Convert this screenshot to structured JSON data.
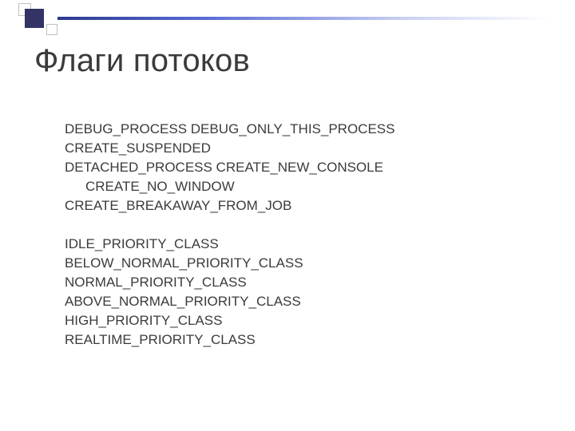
{
  "title": "Флаги потоков",
  "group1": {
    "l1": "DEBUG_PROCESS DEBUG_ONLY_THIS_PROCESS",
    "l2": "CREATE_SUSPENDED",
    "l3": "DETACHED_PROCESS CREATE_NEW_CONSOLE",
    "l3b": "CREATE_NO_WINDOW",
    "l4": "CREATE_BREAKAWAY_FROM_JOB"
  },
  "group2": {
    "l1": "IDLE_PRIORITY_CLASS",
    "l2": "BELOW_NORMAL_PRIORITY_CLASS",
    "l3": "NORMAL_PRIORITY_CLASS",
    "l4": "ABOVE_NORMAL_PRIORITY_CLASS",
    "l5": "HIGH_PRIORITY_CLASS",
    "l6": "REALTIME_PRIORITY_CLASS"
  }
}
